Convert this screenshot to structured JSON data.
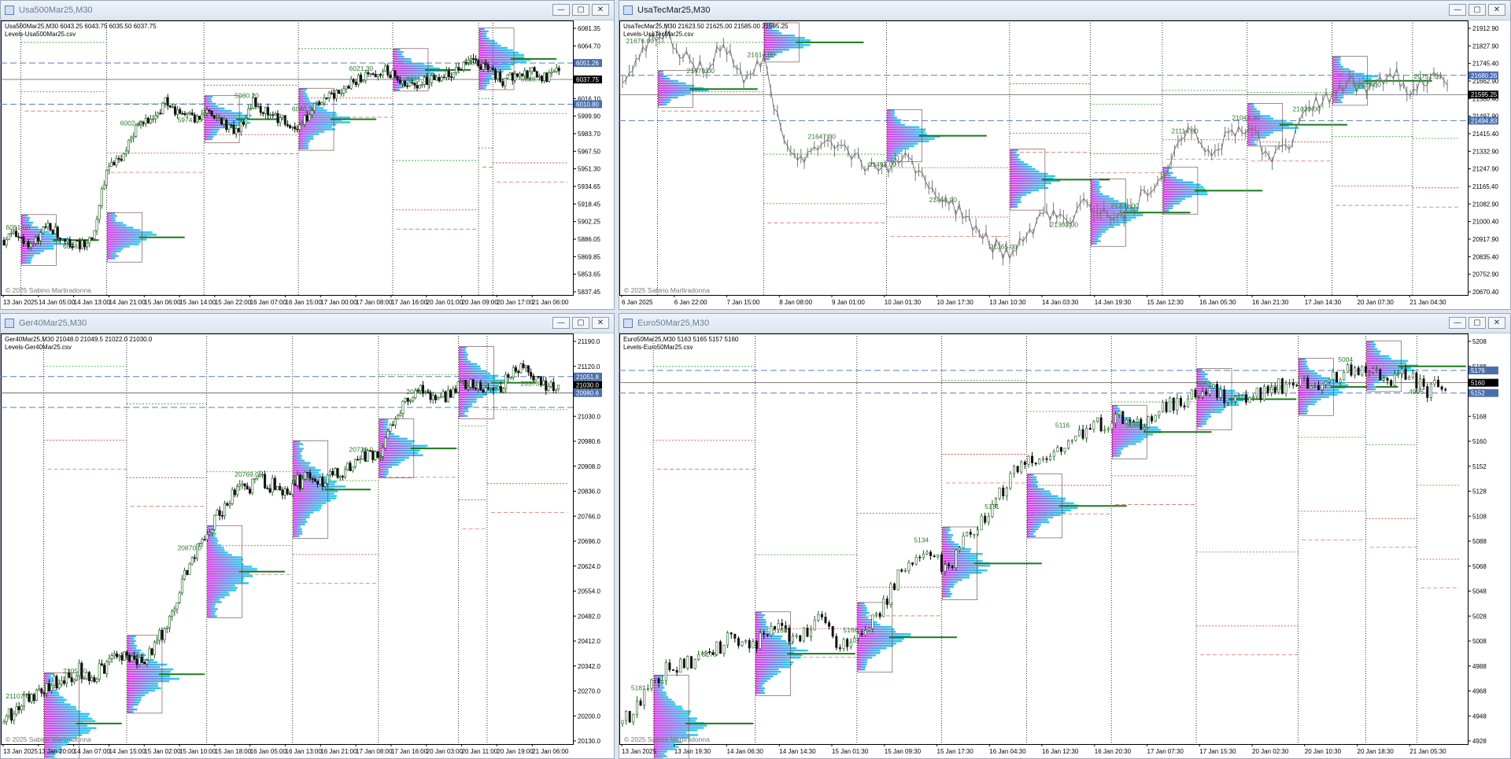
{
  "windows": [
    {
      "title": "Usa500Mar25,M30",
      "active": false,
      "info_line1": "Usa500Mar25,M30  6043.25 6043.75 6035.50 6037.75",
      "info_line2": "Levels-Usa500Mar25.csv",
      "copyright": "© 2025 Sabino Martiradonna",
      "yticks": [
        "6081.35",
        "6064.70",
        "6048.05",
        "6032.30",
        "6016.10",
        "5999.90",
        "5983.70",
        "5967.50",
        "5951.30",
        "5934.65",
        "5918.45",
        "5902.25",
        "5886.05",
        "5869.85",
        "5853.65",
        "5837.45"
      ],
      "xticks": [
        "13 Jan 2025",
        "14 Jan 05:00",
        "14 Jan 13:00",
        "14 Jan 21:00",
        "15 Jan 06:00",
        "15 Jan 14:00",
        "15 Jan 22:00",
        "16 Jan 07:00",
        "16 Jan 15:00",
        "17 Jan 00:00",
        "17 Jan 08:00",
        "17 Jan 16:00",
        "20 Jan 01:00",
        "20 Jan 09:00",
        "20 Jan 17:00",
        "21 Jan 06:00"
      ],
      "price_tags": [
        {
          "label": "6051.26",
          "kind": "level"
        },
        {
          "label": "6037.75",
          "kind": "current"
        },
        {
          "label": "6010.80",
          "kind": "level"
        }
      ],
      "poc_labels": [
        "6051.60",
        "6036.60",
        "6002.40",
        "5974.20",
        "5980.20",
        "6040.20",
        "6021.30",
        "6011.70",
        "5889.50",
        "5888.75"
      ]
    },
    {
      "title": "UsaTecMar25,M30",
      "active": true,
      "info_line1": "UsaTecMar25,M30  21623.50 21625.00 21585.00 21595.25",
      "info_line2": "Levels-UsaTecMar25.csv",
      "copyright": "© 2025 Sabino Martiradonna",
      "yticks": [
        "21912.90",
        "21827.90",
        "21745.40",
        "21662.90",
        "21580.40",
        "21497.90",
        "21415.40",
        "21332.90",
        "21247.90",
        "21165.40",
        "21082.90",
        "21000.40",
        "20917.90",
        "20835.40",
        "20752.90",
        "20670.40"
      ],
      "xticks": [
        "6 Jan 2025",
        "6 Jan 22:00",
        "7 Jan 15:00",
        "8 Jan 08:00",
        "9 Jan 01:00",
        "10 Jan 01:30",
        "10 Jan 17:30",
        "13 Jan 10:30",
        "14 Jan 03:30",
        "14 Jan 19:30",
        "15 Jan 12:30",
        "16 Jan 05:30",
        "16 Jan 21:30",
        "17 Jan 14:30",
        "20 Jan 07:30",
        "21 Jan 04:30"
      ],
      "price_tags": [
        {
          "label": "21680.26",
          "kind": "level"
        },
        {
          "label": "21595.25",
          "kind": "current"
        },
        {
          "label": "21494.83",
          "kind": "level"
        }
      ],
      "poc_labels": [
        "21676.00",
        "21670.00",
        "21614.00",
        "21647.00",
        "21493.00",
        "21468.00",
        "21365.00",
        "21303.00",
        "21331.00",
        "21114.00",
        "21043.00",
        "21033.00",
        "20929.00",
        "20751.00"
      ]
    },
    {
      "title": "Ger40Mar25,M30",
      "active": false,
      "info_line1": "Ger40Mar25,M30  21048.0 21049.5 21022.0 21030.0",
      "info_line2": "Levels-Ger40Mar25.csv",
      "copyright": "© 2025 Sabino Martiradonna",
      "yticks": [
        "21190.0",
        "21120.0",
        "21051.8",
        "21030.0",
        "20980.6",
        "20908.0",
        "20836.0",
        "20766.0",
        "20696.0",
        "20624.0",
        "20554.0",
        "20482.0",
        "20412.0",
        "20342.0",
        "20270.0",
        "20200.0",
        "20130.0"
      ],
      "xticks": [
        "13 Jan 2025",
        "13 Jan 20:00",
        "14 Jan 07:00",
        "14 Jan 15:00",
        "15 Jan 02:00",
        "15 Jan 10:00",
        "15 Jan 18:00",
        "16 Jan 05:00",
        "16 Jan 13:00",
        "16 Jan 21:00",
        "17 Jan 08:00",
        "17 Jan 16:00",
        "20 Jan 03:00",
        "20 Jan 11:00",
        "20 Jan 19:00",
        "21 Jan 06:00"
      ],
      "price_tags": [
        {
          "label": "21051.8",
          "kind": "level"
        },
        {
          "label": "21030.0",
          "kind": "current"
        },
        {
          "label": "20980.6",
          "kind": "level"
        }
      ],
      "poc_labels": [
        "21107.0",
        "21050.0",
        "21013.0",
        "20870.0",
        "20769.0",
        "20758.0",
        "20739.0",
        "20473.0",
        "20413.0",
        "20373.0"
      ]
    },
    {
      "title": "Euro50Mar25,M30",
      "active": false,
      "info_line1": "Euro50Mar25,M30  5163 5165 5157 5160",
      "info_line2": "Levels-Euro50Mar25.csv",
      "copyright": "© 2025 Sabino Martiradonna",
      "yticks": [
        "5208",
        "5188",
        "5176",
        "5168",
        "5160",
        "5152",
        "5128",
        "5108",
        "5088",
        "5068",
        "5048",
        "5028",
        "5008",
        "4988",
        "4968",
        "4948",
        "4928"
      ],
      "xticks": [
        "13 Jan 2025",
        "13 Jan 19:30",
        "14 Jan 06:30",
        "14 Jan 14:30",
        "15 Jan 01:30",
        "15 Jan 09:30",
        "15 Jan 17:30",
        "16 Jan 04:30",
        "16 Jan 12:30",
        "16 Jan 20:30",
        "17 Jan 07:30",
        "17 Jan 15:30",
        "20 Jan 02:30",
        "20 Jan 10:30",
        "20 Jan 18:30",
        "21 Jan 05:30"
      ],
      "price_tags": [
        {
          "label": "5176",
          "kind": "level"
        },
        {
          "label": "5160",
          "kind": "current"
        },
        {
          "label": "5152",
          "kind": "level"
        }
      ],
      "poc_labels": [
        "5181",
        "5176",
        "5168",
        "5166",
        "5134",
        "5131",
        "5116",
        "5088",
        "5052",
        "5017",
        "5004",
        "4996"
      ]
    }
  ],
  "colors": {
    "axis_text": "#000000",
    "grid_dotted": "#000000",
    "level_line": "#5b7fb3",
    "current_tag": "#000000",
    "level_tag": "#4a6fb0",
    "poc_text": "#2a7a2a",
    "poc_line": "#1a7a1a",
    "profile_magenta": "#e13be8",
    "profile_cyan": "#1fd4ee",
    "candle_up": "#1a5c1a",
    "candle_down": "#111111",
    "nasdaq_line": "#777777",
    "va_red": "#c0392b",
    "va_green": "#2e9b2e",
    "va_teal": "#4cc2c8"
  }
}
